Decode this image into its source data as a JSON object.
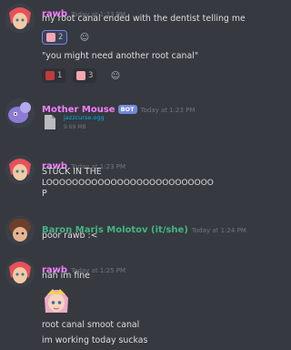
{
  "messages": [
    {
      "username": "rawb",
      "username_color": "#f47fff",
      "timestamp": "Today at 1:23 PM",
      "lines": [
        "my root canal ended with the dentist telling me"
      ],
      "reactions": [
        {
          "count": "2",
          "emoji": "tooth-emoji"
        }
      ],
      "lines2": [
        "\"you might need another root canal\""
      ],
      "reactions2": [
        {
          "count": "1",
          "emoji": "crying-emoji"
        },
        {
          "count": "3",
          "emoji": "tooth-emoji"
        }
      ]
    },
    {
      "username": "Mother Mouse",
      "username_color": "#f47fff",
      "bot_badge": "BOT",
      "timestamp": "Today at 1:23 PM",
      "attachment": {
        "filename": "jazzcurse.ogg",
        "size": "9.69 MB"
      }
    },
    {
      "username": "rawb",
      "username_color": "#f47fff",
      "timestamp": "Today at 1:23 PM",
      "lines": [
        "STUCK IN THE",
        "LOOOOOOOOOOOOOOOOOOOOOOOOOO",
        "P"
      ]
    },
    {
      "username": "Baron Maris Molotov (it/she)",
      "username_color": "#43b581",
      "timestamp": "Today at 1:24 PM",
      "lines": [
        "poor rawb :<"
      ]
    },
    {
      "username": "rawb",
      "username_color": "#f47fff",
      "timestamp": "Today at 1:25 PM",
      "lines": [
        "nah im fine"
      ],
      "lines2": [
        "root canal smoot canal",
        "im working today suckas"
      ]
    }
  ]
}
